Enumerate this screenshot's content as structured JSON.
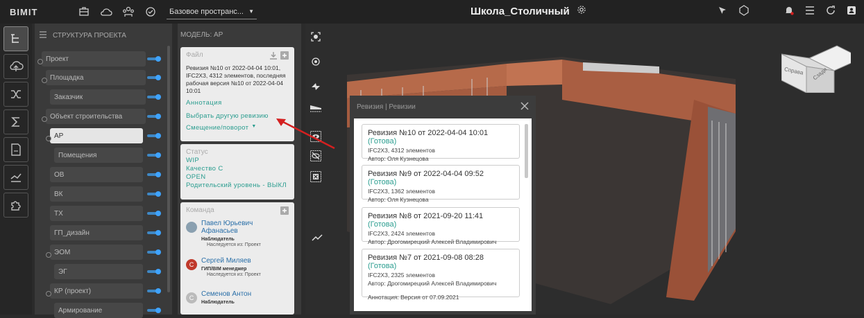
{
  "topbar": {
    "logo": "BIMIT",
    "space_select": "Базовое пространс...",
    "project_title": "Школа_Столичный"
  },
  "tree": {
    "header": "СТРУКТУРА ПРОЕКТА",
    "items": [
      {
        "label": "Проект"
      },
      {
        "label": "Площадка"
      },
      {
        "label": "Заказчик"
      },
      {
        "label": "Объект строительства"
      },
      {
        "label": "АР"
      },
      {
        "label": "Помещения"
      },
      {
        "label": "ОВ"
      },
      {
        "label": "ВК"
      },
      {
        "label": "ТХ"
      },
      {
        "label": "ГП_дизайн"
      },
      {
        "label": "ЭОМ"
      },
      {
        "label": "ЭГ"
      },
      {
        "label": "КР (проект)"
      },
      {
        "label": "Армирование"
      }
    ]
  },
  "model": {
    "header": "МОДЕЛЬ: АР",
    "file": {
      "title": "Файл",
      "text": "Ревизия №10 от 2022-04-04 10:01, IFC2X3, 4312 элементов, последняя рабочая версия №10 от 2022-04-04 10:01",
      "annotation": "Аннотация",
      "choose_revision": "Выбрать другую ревизию",
      "offset": "Смещение/поворот"
    },
    "status": {
      "title": "Статус",
      "wip": "WIP",
      "quality": "Качество С",
      "open": "OPEN",
      "parent": "Родительский уровень - ВЫКЛ"
    },
    "team": {
      "title": "Команда",
      "members": [
        {
          "initial": "",
          "name": "Павел Юрьевич Афанасьев",
          "role": "Наблюдатель",
          "inherit": "Наследуется из: Проект"
        },
        {
          "initial": "С",
          "name": "Сергей Миляев",
          "role": "ГИП/BIM менеджер",
          "inherit": "Наследуется из: Проект"
        },
        {
          "initial": "С",
          "name": "Семенов Антон",
          "role": "Наблюдатель",
          "inherit": ""
        }
      ]
    }
  },
  "modal": {
    "title": "Ревизия | Ревизии",
    "revisions": [
      {
        "title": "Ревизия №10 от 2022-04-04 10:01",
        "status": "(Готова)",
        "elements": "IFC2X3, 4312 элементов",
        "author": "Автор: Оля Кузнецова",
        "annotation": ""
      },
      {
        "title": "Ревизия №9 от 2022-04-04 09:52",
        "status": "(Готова)",
        "elements": "IFC2X3, 1362 элементов",
        "author": "Автор: Оля Кузнецова",
        "annotation": ""
      },
      {
        "title": "Ревизия №8 от 2021-09-20 11:41",
        "status": "(Готова)",
        "elements": "IFC2X3, 2424 элементов",
        "author": "Автор: Дрогомирецкий Алексей Владимирович",
        "annotation": ""
      },
      {
        "title": "Ревизия №7 от 2021-09-08 08:28",
        "status": "(Готова)",
        "elements": "IFC2X3, 2325 элементов",
        "author": "Автор: Дрогомирецкий Алексей Владимирович",
        "annotation": "Аннотация: Версия от 07.09.2021"
      }
    ]
  },
  "viewcube": {
    "face1": "Справа",
    "face2": "Сзади"
  },
  "colors": {
    "accent": "#3fa3ff",
    "teal": "#2a9d8f",
    "arrow": "#d42020"
  }
}
